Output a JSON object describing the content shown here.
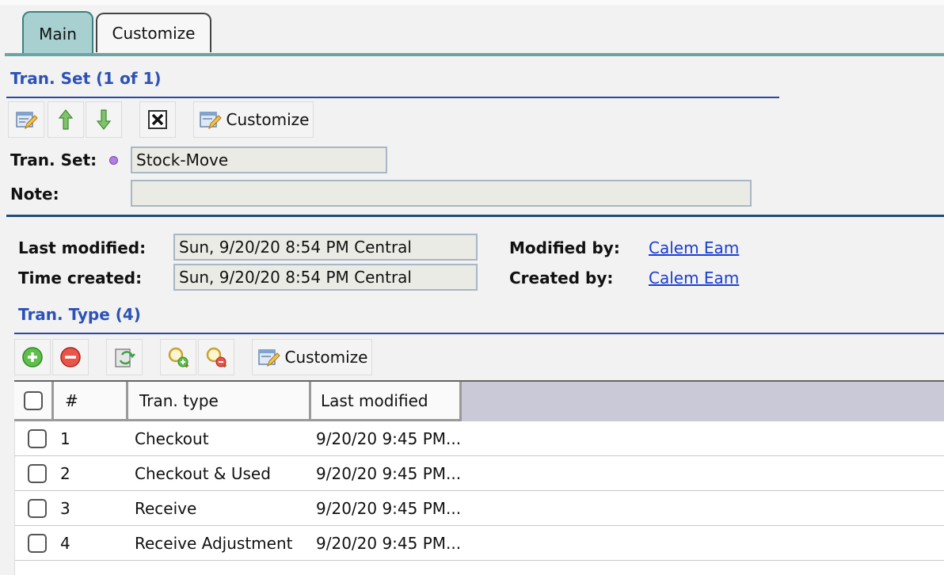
{
  "tabs": [
    {
      "label": "Main",
      "active": true
    },
    {
      "label": "Customize",
      "active": false
    }
  ],
  "tran_set_section": {
    "title": "Tran. Set (1 of 1)",
    "toolbar": {
      "edit_icon": "edit-form-icon",
      "up_icon": "arrow-up-icon",
      "down_icon": "arrow-down-icon",
      "close_icon": "close-box-icon",
      "customize_label": "Customize"
    },
    "fields": {
      "tran_set_label": "Tran. Set:",
      "tran_set_value": "Stock-Move",
      "note_label": "Note:",
      "note_value": ""
    }
  },
  "meta": {
    "last_modified_label": "Last modified:",
    "last_modified_value": "Sun, 9/20/20 8:54 PM Central",
    "time_created_label": "Time created:",
    "time_created_value": "Sun, 9/20/20 8:54 PM Central",
    "modified_by_label": "Modified by:",
    "modified_by_value": "Calem Eam",
    "created_by_label": "Created by:",
    "created_by_value": "Calem Eam"
  },
  "tran_type_section": {
    "title": "Tran. Type (4)",
    "toolbar": {
      "add_icon": "add-icon",
      "remove_icon": "remove-icon",
      "refresh_icon": "refresh-icon",
      "zoom_in_icon": "zoom-in-icon",
      "zoom_out_icon": "zoom-out-icon",
      "customize_label": "Customize"
    },
    "columns": [
      "#",
      "Tran. type",
      "Last modified"
    ],
    "rows": [
      {
        "num": "1",
        "type": "Checkout",
        "modified": "9/20/20 9:45 PM..."
      },
      {
        "num": "2",
        "type": "Checkout & Used",
        "modified": "9/20/20 9:45 PM..."
      },
      {
        "num": "3",
        "type": "Receive",
        "modified": "9/20/20 9:45 PM..."
      },
      {
        "num": "4",
        "type": "Receive Adjustment",
        "modified": "9/20/20 9:45 PM..."
      }
    ]
  },
  "colors": {
    "accent": "#2c52b8",
    "tab_active": "#a8d0d0",
    "link": "#1a3ed0",
    "required_dot": "#b07fe0"
  }
}
